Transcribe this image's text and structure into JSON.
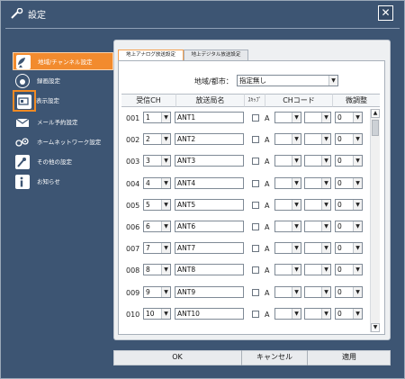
{
  "window": {
    "title": "設定",
    "close_symbol": "✕"
  },
  "sidebar": {
    "items": [
      {
        "label": "地域/チャンネル設定",
        "icon": "satellite-dish-icon"
      },
      {
        "label": "録画設定",
        "icon": "record-icon"
      },
      {
        "label": "表示設定",
        "icon": "display-icon"
      },
      {
        "label": "メール予約設定",
        "icon": "mail-icon"
      },
      {
        "label": "ホームネットワーク設定",
        "icon": "network-icon"
      },
      {
        "label": "その他の設定",
        "icon": "tools-icon"
      },
      {
        "label": "お知らせ",
        "icon": "info-icon"
      }
    ]
  },
  "tabs": [
    {
      "label": "地上アナログ放送設定"
    },
    {
      "label": "地上デジタル放送設定"
    }
  ],
  "region": {
    "label": "地域/都市：",
    "value": "指定無し"
  },
  "columns": {
    "ch": "受信CH",
    "name": "放送局名",
    "skip": "ｽｷｯﾌﾟ",
    "code": "CHコード",
    "fine": "微調整"
  },
  "rows": [
    {
      "num": "001",
      "ch": "1",
      "name": "ANT1",
      "a": "A",
      "fine": "0"
    },
    {
      "num": "002",
      "ch": "2",
      "name": "ANT2",
      "a": "A",
      "fine": "0"
    },
    {
      "num": "003",
      "ch": "3",
      "name": "ANT3",
      "a": "A",
      "fine": "0"
    },
    {
      "num": "004",
      "ch": "4",
      "name": "ANT4",
      "a": "A",
      "fine": "0"
    },
    {
      "num": "005",
      "ch": "5",
      "name": "ANT5",
      "a": "A",
      "fine": "0"
    },
    {
      "num": "006",
      "ch": "6",
      "name": "ANT6",
      "a": "A",
      "fine": "0"
    },
    {
      "num": "007",
      "ch": "7",
      "name": "ANT7",
      "a": "A",
      "fine": "0"
    },
    {
      "num": "008",
      "ch": "8",
      "name": "ANT8",
      "a": "A",
      "fine": "0"
    },
    {
      "num": "009",
      "ch": "9",
      "name": "ANT9",
      "a": "A",
      "fine": "0"
    },
    {
      "num": "010",
      "ch": "10",
      "name": "ANT10",
      "a": "A",
      "fine": "0"
    }
  ],
  "footer": {
    "ok": "OK",
    "cancel": "キャンセル",
    "apply": "適用"
  },
  "colors": {
    "window_bg": "#3d5573",
    "accent": "#f28b2e"
  }
}
